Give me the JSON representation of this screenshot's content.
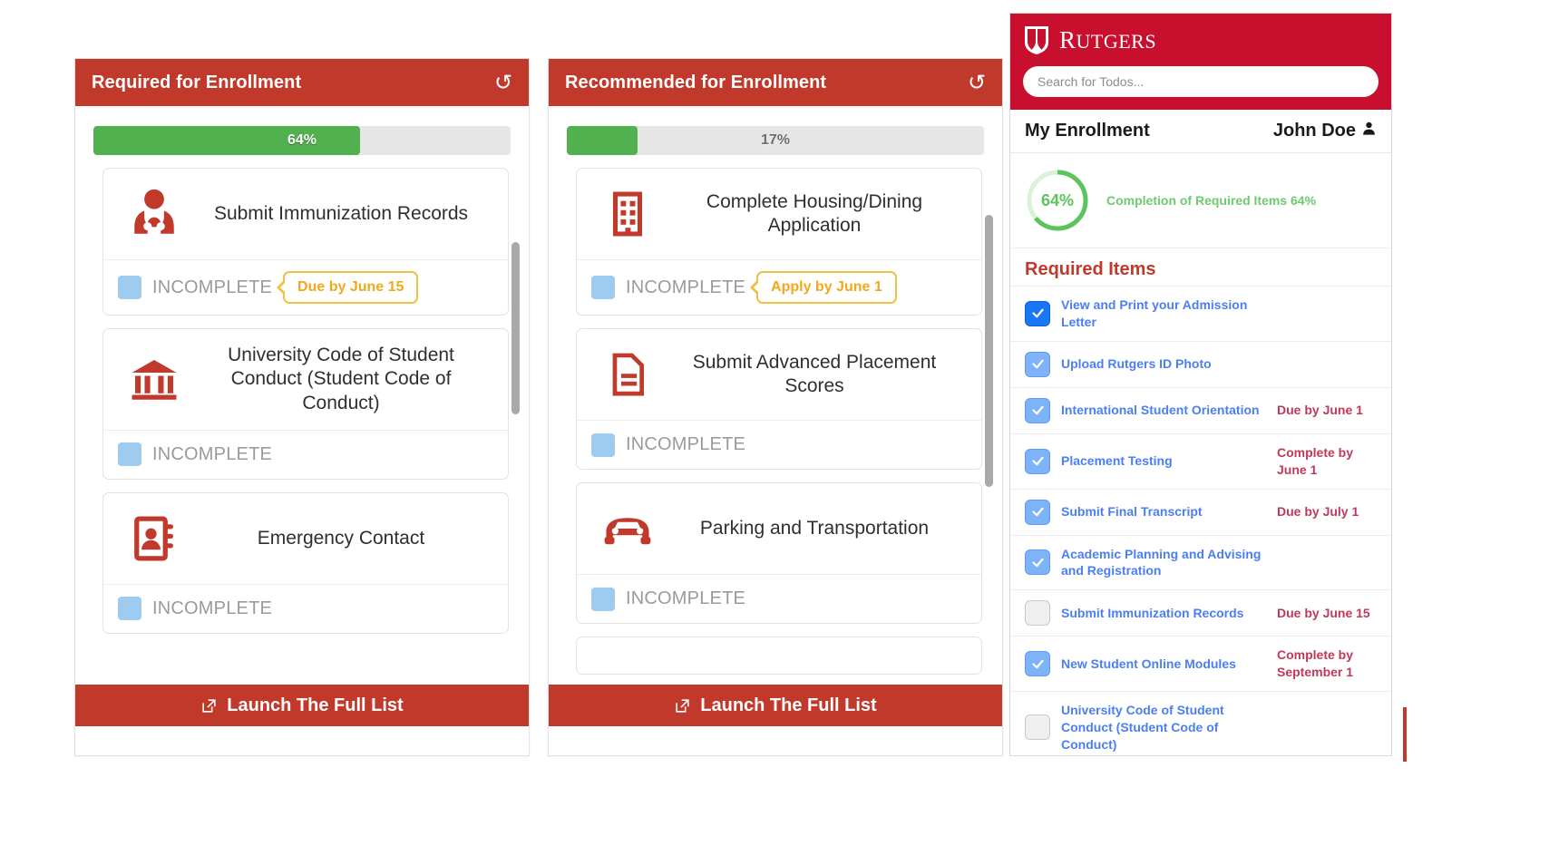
{
  "desktop": {
    "cards": [
      {
        "title": "Required for Enrollment",
        "refresh_icon": "refresh-icon",
        "progress": {
          "percent": 64,
          "label": "64%"
        },
        "footer_label": "Launch The Full List",
        "footer_icon": "external-link-icon",
        "items": [
          {
            "icon": "doctor-icon",
            "label": "Submit Immunization Records",
            "status": "INCOMPLETE",
            "due": "Due by June 15"
          },
          {
            "icon": "bank-icon",
            "label": "University Code of Student Conduct (Student Code of Conduct)",
            "status": "INCOMPLETE",
            "due": ""
          },
          {
            "icon": "address-book-icon",
            "label": "Emergency Contact",
            "status": "INCOMPLETE",
            "due": ""
          }
        ]
      },
      {
        "title": "Recommended for Enrollment",
        "refresh_icon": "refresh-icon",
        "progress": {
          "percent": 17,
          "label": "17%"
        },
        "footer_label": "Launch The Full List",
        "footer_icon": "external-link-icon",
        "items": [
          {
            "icon": "building-icon",
            "label": "Complete Housing/Dining Application",
            "status": "INCOMPLETE",
            "due": "Apply by June 1"
          },
          {
            "icon": "document-icon",
            "label": "Submit Advanced Placement Scores",
            "status": "INCOMPLETE",
            "due": ""
          },
          {
            "icon": "car-icon",
            "label": "Parking and Transportation",
            "status": "INCOMPLETE",
            "due": ""
          }
        ]
      }
    ]
  },
  "mobile": {
    "brand": "RUTGERS",
    "brand_icon": "rutgers-shield-icon",
    "search": {
      "placeholder": "Search for Todos...",
      "value": ""
    },
    "subheader": {
      "left": "My Enrollment",
      "user": "John Doe",
      "user_icon": "user-icon"
    },
    "progress": {
      "percent": 64,
      "label": "64%",
      "caption": "Completion of Required Items 64%"
    },
    "section_title": "Required Items",
    "items": [
      {
        "checked": true,
        "focused": true,
        "name": "View and Print your Admission Letter",
        "due": ""
      },
      {
        "checked": true,
        "focused": false,
        "name": "Upload Rutgers ID Photo",
        "due": ""
      },
      {
        "checked": true,
        "focused": false,
        "name": "International Student Orientation",
        "due": "Due by June 1"
      },
      {
        "checked": true,
        "focused": false,
        "name": "Placement Testing",
        "due": "Complete by June 1"
      },
      {
        "checked": true,
        "focused": false,
        "name": "Submit Final Transcript",
        "due": "Due by July 1"
      },
      {
        "checked": true,
        "focused": false,
        "name": "Academic Planning and Advising and Registration",
        "due": ""
      },
      {
        "checked": false,
        "focused": false,
        "name": "Submit Immunization Records",
        "due": "Due by June 15"
      },
      {
        "checked": true,
        "focused": false,
        "name": "New Student Online Modules",
        "due": "Complete by September 1"
      },
      {
        "checked": false,
        "focused": false,
        "name": "University Code of Student Conduct (Student Code of Conduct)",
        "due": ""
      }
    ]
  },
  "colors": {
    "brand_red": "#c0392b",
    "header_red": "#c8102e",
    "progress_green": "#52b14f",
    "ring_green": "#5cc45c",
    "due_yellow": "#f2a81d",
    "status_blue": "#9ecbf0",
    "link_blue": "#4c7ef3",
    "due_red": "#c0395a"
  }
}
